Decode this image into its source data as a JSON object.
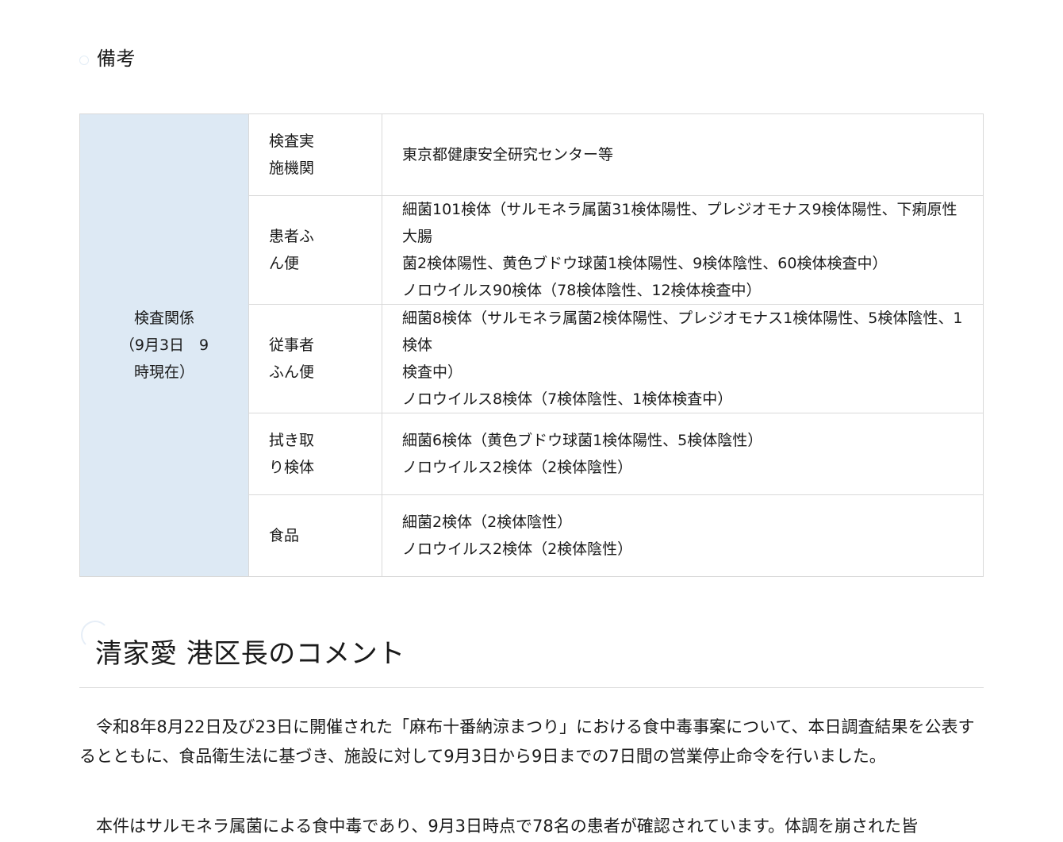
{
  "remarks_heading": "備考",
  "table": {
    "group_label_1": "検査関係",
    "group_label_2": "（9月3日　9",
    "group_label_3": "時現在）",
    "rows": [
      {
        "label": [
          "検査実",
          "施機関"
        ],
        "value": [
          "東京都健康安全研究センター等"
        ]
      },
      {
        "label": [
          "患者ふ",
          "ん便"
        ],
        "value": [
          "細菌101検体（サルモネラ属菌31検体陽性、プレジオモナス9検体陽性、下痢原性大腸",
          "菌2検体陽性、黄色ブドウ球菌1検体陽性、9検体陰性、60検体検査中）",
          "ノロウイルス90検体（78検体陰性、12検体検査中）"
        ]
      },
      {
        "label": [
          "従事者",
          "ふん便"
        ],
        "value": [
          "細菌8検体（サルモネラ属菌2検体陽性、プレジオモナス1検体陽性、5検体陰性、1検体",
          "検査中）",
          "ノロウイルス8検体（7検体陰性、1検体検査中）"
        ]
      },
      {
        "label": [
          "拭き取",
          "り検体"
        ],
        "value": [
          "細菌6検体（黄色ブドウ球菌1検体陽性、5検体陰性）",
          "ノロウイルス2検体（2検体陰性）"
        ]
      },
      {
        "label": [
          "食品"
        ],
        "value": [
          "細菌2検体（2検体陰性）",
          "ノロウイルス2検体（2検体陰性）"
        ]
      }
    ]
  },
  "comment_heading": "清家愛 港区長のコメント",
  "paragraphs": [
    "令和8年8月22日及び23日に開催された「麻布十番納涼まつり」における食中毒事案について、本日調査結果を公表するとともに、食品衛生法に基づき、施設に対して9月3日から9日までの7日間の営業停止命令を行いました。",
    "本件はサルモネラ属菌による食中毒であり、9月3日時点で78名の患者が確認されています。体調を崩された皆"
  ]
}
